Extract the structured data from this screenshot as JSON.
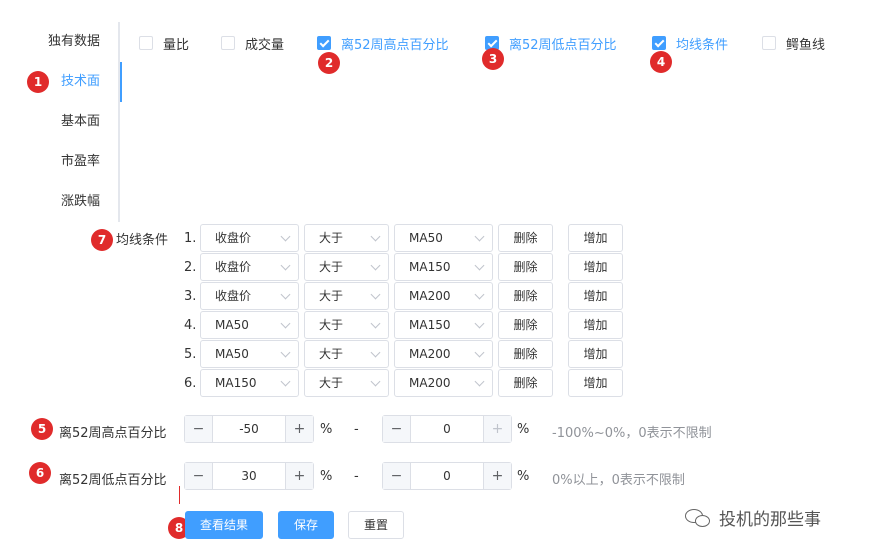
{
  "sidebar": {
    "items": [
      {
        "label": "独有数据"
      },
      {
        "label": "技术面"
      },
      {
        "label": "基本面"
      },
      {
        "label": "市盈率"
      },
      {
        "label": "涨跌幅"
      }
    ]
  },
  "filters": {
    "volume_ratio": "量比",
    "volume": "成交量",
    "pct_from_52w_high": "离52周高点百分比",
    "pct_from_52w_low": "离52周低点百分比",
    "ma_condition": "均线条件",
    "alligator": "鳄鱼线"
  },
  "badges": [
    "1",
    "2",
    "3",
    "4",
    "5",
    "6",
    "7",
    "8"
  ],
  "ma_conditions": {
    "label": "均线条件",
    "delete_label": "删除",
    "add_label": "增加",
    "rows": [
      {
        "num": "1.",
        "left": "收盘价",
        "op": "大于",
        "right": "MA50"
      },
      {
        "num": "2.",
        "left": "收盘价",
        "op": "大于",
        "right": "MA150"
      },
      {
        "num": "3.",
        "left": "收盘价",
        "op": "大于",
        "right": "MA200"
      },
      {
        "num": "4.",
        "left": "MA50",
        "op": "大于",
        "right": "MA150"
      },
      {
        "num": "5.",
        "left": "MA50",
        "op": "大于",
        "right": "MA200"
      },
      {
        "num": "6.",
        "left": "MA150",
        "op": "大于",
        "right": "MA200"
      }
    ]
  },
  "range_high": {
    "label": "离52周高点百分比",
    "from": "-50",
    "to": "0",
    "unit": "%",
    "dash": "-",
    "hint": "-100%~0%，0表示不限制"
  },
  "range_low": {
    "label": "离52周低点百分比",
    "from": "30",
    "to": "0",
    "unit": "%",
    "dash": "-",
    "hint": "0%以上，0表示不限制"
  },
  "actions": {
    "view_results": "查看结果",
    "save": "保存",
    "reset": "重置"
  },
  "stepper_symbols": {
    "minus": "−",
    "plus": "+"
  },
  "watermark": "投机的那些事",
  "colors": {
    "accent": "#409eff",
    "badge": "#e02b2b"
  }
}
